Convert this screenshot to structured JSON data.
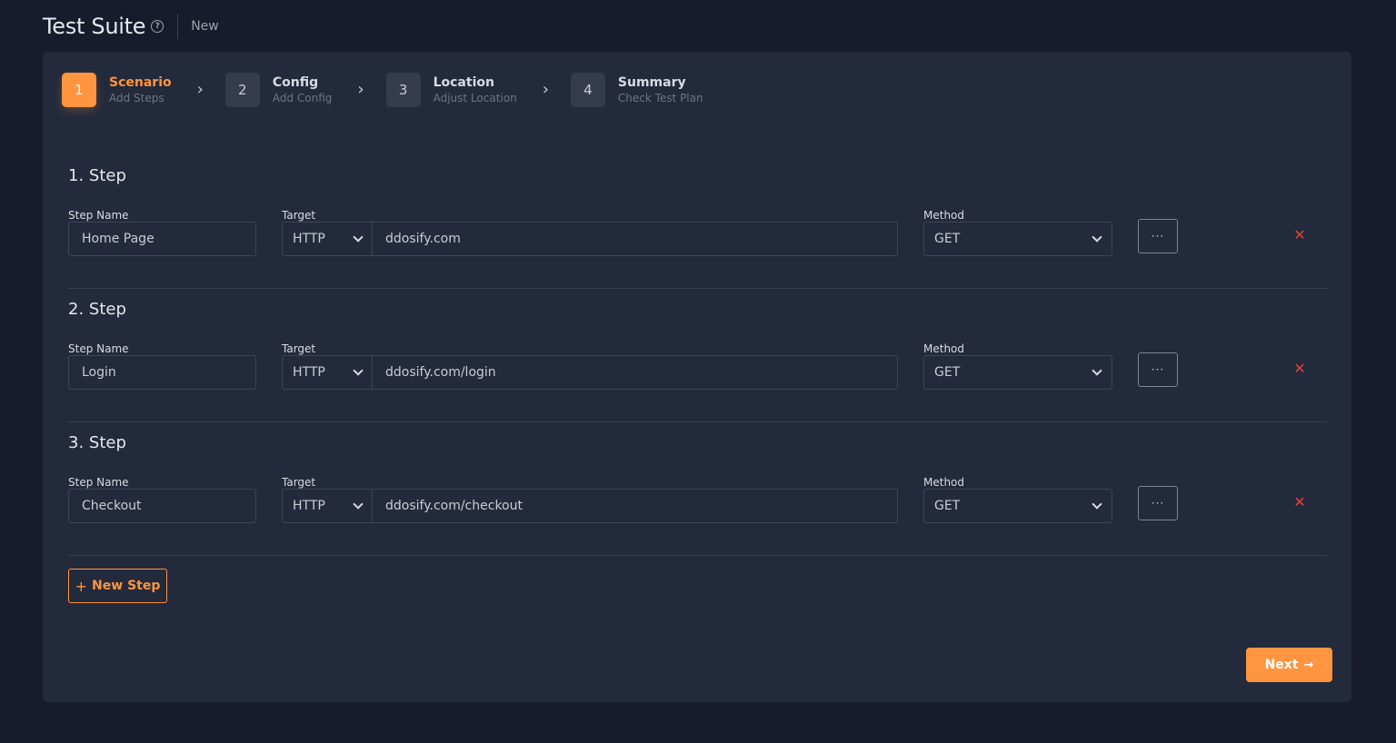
{
  "header": {
    "title": "Test Suite",
    "status": "New"
  },
  "stepper": [
    {
      "num": "1",
      "title": "Scenario",
      "subtitle": "Add Steps",
      "active": true
    },
    {
      "num": "2",
      "title": "Config",
      "subtitle": "Add Config",
      "active": false
    },
    {
      "num": "3",
      "title": "Location",
      "subtitle": "Adjust Location",
      "active": false
    },
    {
      "num": "4",
      "title": "Summary",
      "subtitle": "Check Test Plan",
      "active": false
    }
  ],
  "labels": {
    "step_name": "Step Name",
    "target": "Target",
    "method": "Method"
  },
  "steps": [
    {
      "heading": "1. Step",
      "name": "Home Page",
      "protocol": "HTTP",
      "url": "ddosify.com",
      "method": "GET"
    },
    {
      "heading": "2. Step",
      "name": "Login",
      "protocol": "HTTP",
      "url": "ddosify.com/login",
      "method": "GET"
    },
    {
      "heading": "3. Step",
      "name": "Checkout",
      "protocol": "HTTP",
      "url": "ddosify.com/checkout",
      "method": "GET"
    }
  ],
  "actions": {
    "new_step": "New Step",
    "next": "Next"
  },
  "icons": {
    "help": "help-circle-icon",
    "more": "ellipsis-icon",
    "remove": "close-icon",
    "chevron": "chevron-right-icon",
    "plus": "plus-icon",
    "arrow": "arrow-right-icon"
  },
  "colors": {
    "accent": "#ff9441",
    "background": "#161c2b",
    "card": "#222a3b",
    "danger": "#e0453a"
  }
}
